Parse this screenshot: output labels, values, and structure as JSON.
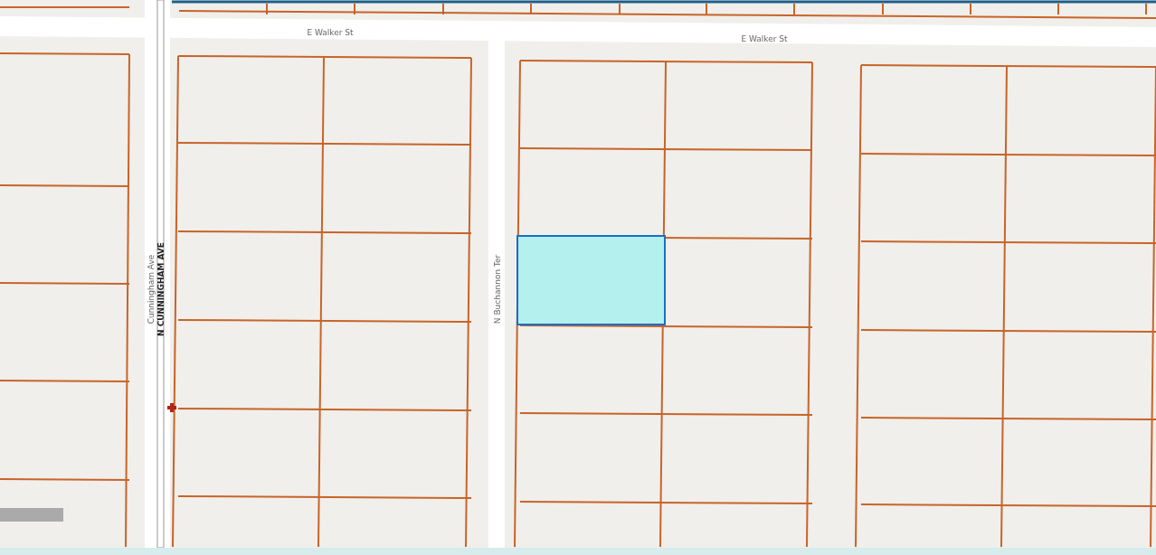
{
  "map": {
    "streets": [
      {
        "name": "E Walker St",
        "kind": "horizontal"
      },
      {
        "name": "E Walker St",
        "kind": "horizontal"
      },
      {
        "name": "Cunningham Ave",
        "kind": "vertical"
      },
      {
        "name": "N CUNNINGHAM AVE",
        "kind": "vertical-bold"
      },
      {
        "name": "N Buchannon Ter",
        "kind": "vertical"
      }
    ],
    "selected_parcel": true
  }
}
